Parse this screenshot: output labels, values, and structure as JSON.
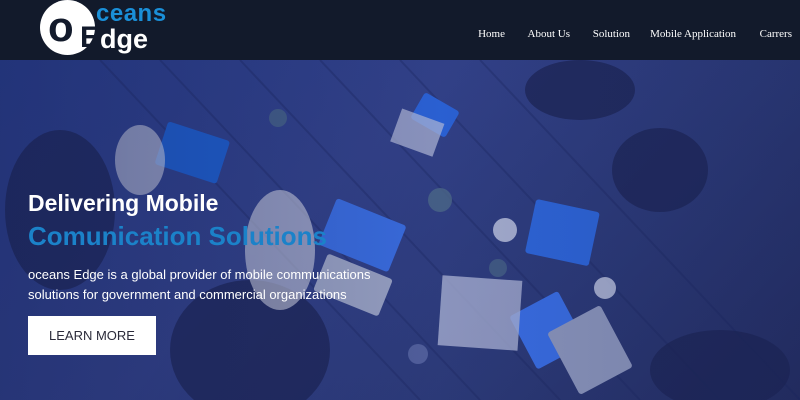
{
  "brand": {
    "logo_o": "o",
    "logo_ceans": "ceans",
    "logo_e": "E",
    "logo_dge": "dge"
  },
  "nav": {
    "items": [
      {
        "label": "Home"
      },
      {
        "label": "About Us"
      },
      {
        "label": "Solution"
      },
      {
        "label": "Mobile Application"
      },
      {
        "label": "Carrers"
      }
    ]
  },
  "hero": {
    "title_line1": "Delivering Mobile",
    "title_line2": "Comunication Solutions",
    "description": "oceans Edge is a global provider of mobile communications solutions for government and commercial organizations",
    "cta_label": "LEARN MORE",
    "background_icon": "team-meeting-photo"
  },
  "colors": {
    "nav_bg": "#121a2b",
    "brand_blue": "#1a8fd8",
    "headline_blue": "#1b82c9",
    "hero_tint": "#2f4290"
  }
}
